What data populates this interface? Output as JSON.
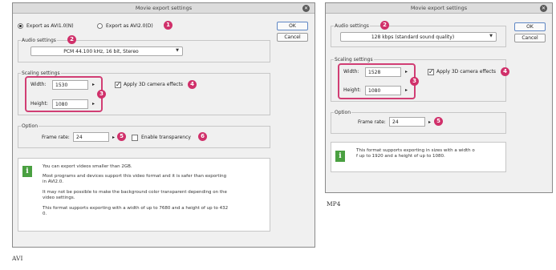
{
  "avi": {
    "title": "Movie export settings",
    "close_glyph": "✕",
    "radio_avi1": "Export as AVI1.0(N)",
    "radio_avi2": "Export as AVI2.0(D)",
    "audio_label": "Audio settings",
    "audio_value": "PCM 44.100 kHz, 16 bit, Stereo",
    "scaling_label": "Scaling settings",
    "width_label": "Width:",
    "width_value": "1530",
    "height_label": "Height:",
    "height_value": "1080",
    "apply3d_label": "Apply 3D camera effects",
    "option_label": "Option",
    "framerate_label": "Frame rate:",
    "framerate_value": "24",
    "transparency_label": "Enable transparency",
    "ok_label": "OK",
    "cancel_label": "Cancel",
    "info_p1": "You can export videos smaller than 2GB.",
    "info_p2a": "Most programs and devices support this video format and it is safer than exporting",
    "info_p2b": "in AVI2.0.",
    "info_p3a": "It may not be possible to make the background color transparent depending on the",
    "info_p3b": "video settings.",
    "info_p4a": "This format supports exporting with a width of up to 7680 and a height of up to 432",
    "info_p4b": "0.",
    "badges": [
      "1",
      "2",
      "3",
      "4",
      "5",
      "6"
    ]
  },
  "mp4": {
    "title": "Movie export settings",
    "close_glyph": "✕",
    "audio_label": "Audio settings",
    "audio_value": "128 kbps (standard sound quality)",
    "scaling_label": "Scaling settings",
    "width_label": "Width:",
    "width_value": "1528",
    "height_label": "Height:",
    "height_value": "1080",
    "apply3d_label": "Apply 3D camera effects",
    "option_label": "Option",
    "framerate_label": "Frame rate:",
    "framerate_value": "24",
    "ok_label": "OK",
    "cancel_label": "Cancel",
    "info_a": "This format supports exporting in sizes with a width o",
    "info_b": "f up to 1920 and a height of up to 1080.",
    "badges": [
      "2",
      "3",
      "4",
      "5"
    ]
  },
  "captions": {
    "avi": "AVI",
    "mp4": "MP4"
  },
  "icons": {
    "info": "info-icon",
    "spin": "▸",
    "dropdown": "▼",
    "check": "✓"
  },
  "colors": {
    "highlight": "#d13e74",
    "badge": "#d0306a",
    "info_icon": "#4aa041"
  }
}
